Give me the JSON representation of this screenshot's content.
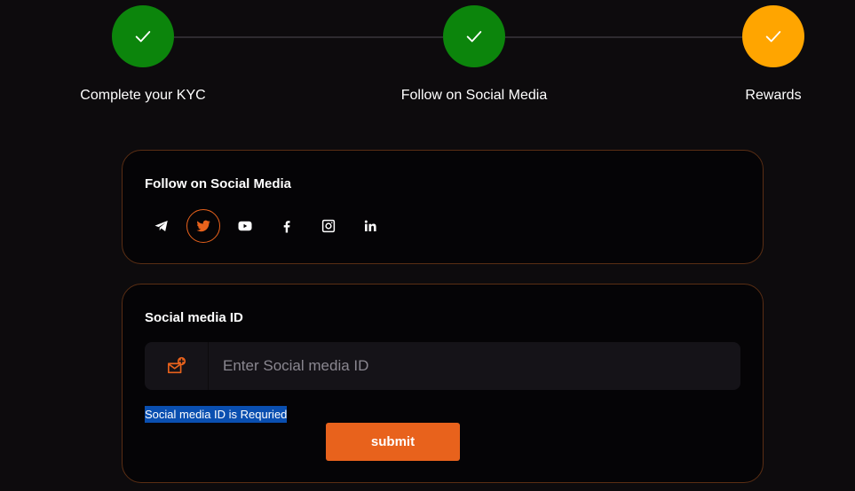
{
  "stepper": {
    "steps": [
      {
        "label": "Complete your KYC",
        "status": "done",
        "color": "#0c850c"
      },
      {
        "label": "Follow on Social Media",
        "status": "done",
        "color": "#0c850c"
      },
      {
        "label": "Rewards",
        "status": "current",
        "color": "#ffa500"
      }
    ],
    "check_icon": "check-icon"
  },
  "social_card": {
    "title": "Follow on Social Media",
    "icons": [
      "telegram-icon",
      "twitter-icon",
      "youtube-icon",
      "facebook-icon",
      "instagram-icon",
      "linkedin-icon"
    ],
    "active_icon": "twitter-icon"
  },
  "id_card": {
    "title": "Social media ID",
    "input": {
      "placeholder": "Enter Social media ID",
      "value": "",
      "icon": "mail-plus-icon"
    },
    "error": "Social media ID is Requried",
    "submit_label": "submit"
  },
  "colors": {
    "accent": "#e8621c",
    "background": "#0d0b0d",
    "card_background": "#050406",
    "error_highlight": "#0a4fb0"
  }
}
